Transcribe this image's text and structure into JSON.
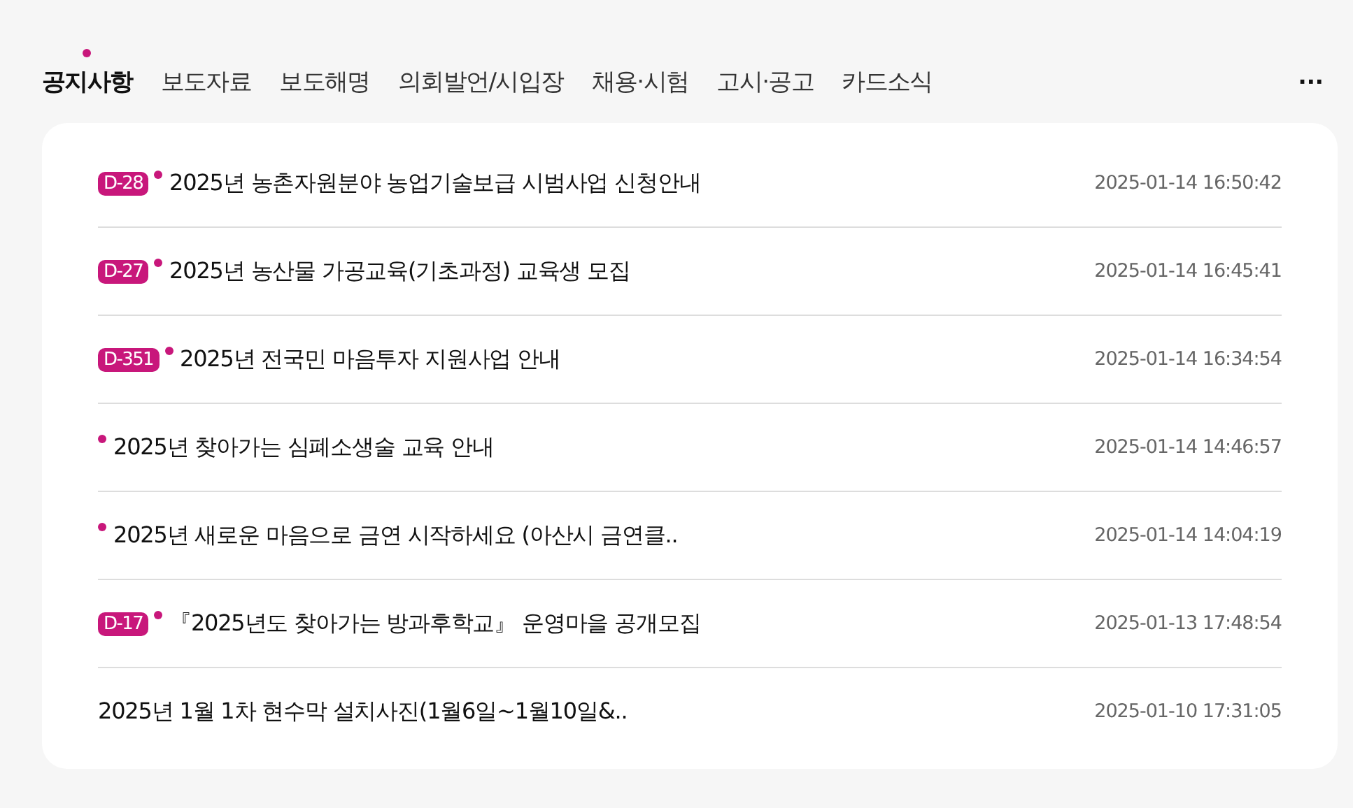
{
  "tabs": [
    {
      "label": "공지사항",
      "selected": true
    },
    {
      "label": "보도자료",
      "selected": false
    },
    {
      "label": "보도해명",
      "selected": false
    },
    {
      "label": "의회발언/시입장",
      "selected": false
    },
    {
      "label": "채용·시험",
      "selected": false
    },
    {
      "label": "고시·공고",
      "selected": false
    },
    {
      "label": "카드소식",
      "selected": false
    }
  ],
  "more_button": "···",
  "notices": [
    {
      "badge": "D-28",
      "new": true,
      "title": "2025년 농촌자원분야 농업기술보급 시범사업 신청안내",
      "date": "2025-01-14 16:50:42"
    },
    {
      "badge": "D-27",
      "new": true,
      "title": "2025년 농산물 가공교육(기초과정) 교육생 모집",
      "date": "2025-01-14 16:45:41"
    },
    {
      "badge": "D-351",
      "new": true,
      "title": "2025년 전국민 마음투자 지원사업 안내",
      "date": "2025-01-14 16:34:54"
    },
    {
      "new": true,
      "title": "2025년 찾아가는 심폐소생술 교육 안내",
      "date": "2025-01-14 14:46:57"
    },
    {
      "new": true,
      "title": "2025년 새로운 마음으로 금연 시작하세요 (아산시 금연클..",
      "date": "2025-01-14 14:04:19"
    },
    {
      "badge": "D-17",
      "new": true,
      "title": "『2025년도 찾아가는 방과후학교』 운영마을 공개모집",
      "date": "2025-01-13 17:48:54"
    },
    {
      "new": false,
      "title": "2025년 1월 1차 현수막 설치사진(1월6일~1월10일&..",
      "date": "2025-01-10 17:31:05"
    }
  ]
}
